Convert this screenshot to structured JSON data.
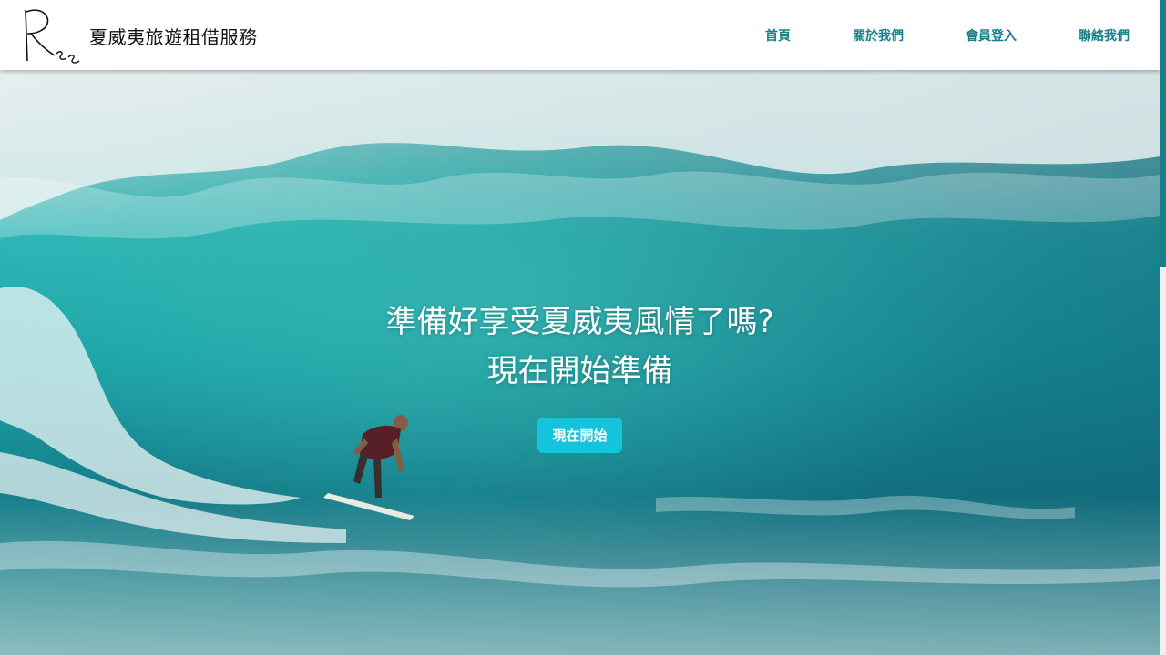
{
  "brand": {
    "logo_text": "Ree",
    "name": "夏威夷旅遊租借服務"
  },
  "nav": {
    "items": [
      {
        "label": "首頁"
      },
      {
        "label": "關於我們"
      },
      {
        "label": "會員登入"
      },
      {
        "label": "聯絡我們"
      }
    ]
  },
  "hero": {
    "title_line1": "準備好享受夏威夷風情了嗎?",
    "title_line2": "現在開始準備",
    "cta_label": "現在開始"
  },
  "colors": {
    "accent": "#17808a",
    "cta": "#13c4dc",
    "sea": "#1fa8aa",
    "foam": "#e9f1f1"
  },
  "scroll": {
    "position_fraction": 0.0
  }
}
